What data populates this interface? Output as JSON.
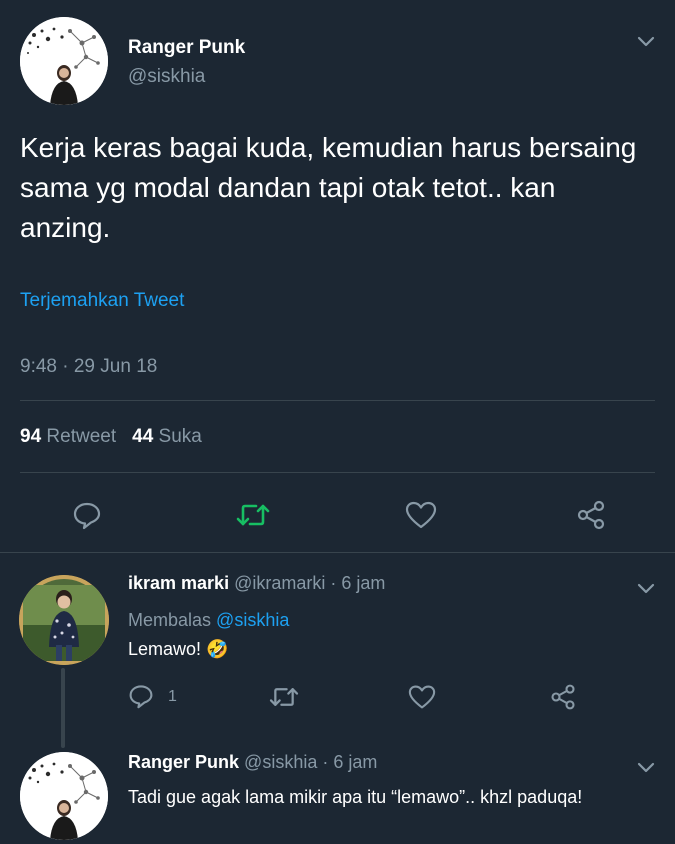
{
  "main_tweet": {
    "display_name": "Ranger Punk",
    "handle": "@siskhia",
    "text": "Kerja keras bagai kuda, kemudian harus bersaing sama yg modal dandan tapi otak tetot.. kan anzing.",
    "translate_label": "Terjemahkan Tweet",
    "timestamp": "9:48 · 29 Jun 18",
    "retweet_count": "94",
    "retweet_label": "Retweet",
    "like_count": "44",
    "like_label": "Suka",
    "icons": {
      "reply": "reply-icon",
      "retweet": "retweet-icon",
      "like": "heart-icon",
      "share": "share-icon",
      "more": "chevron-down-icon"
    },
    "retweet_color": "#17bf63"
  },
  "replies": [
    {
      "display_name": "ikram marki",
      "handle": "@ikramarki",
      "time": "· 6 jam",
      "replying_to_label": "Membalas",
      "replying_to_handle": "@siskhia",
      "text": "Lemawo! 🤣",
      "reply_count": "1"
    },
    {
      "display_name": "Ranger Punk",
      "handle": "@siskhia",
      "time": "· 6 jam",
      "text": "Tadi gue agak lama mikir apa itu “lemawo”.. khzl paduqa!"
    }
  ],
  "colors": {
    "background": "#1c2733",
    "link": "#1da1f2",
    "muted": "#8899a6",
    "divider": "#38444d"
  }
}
